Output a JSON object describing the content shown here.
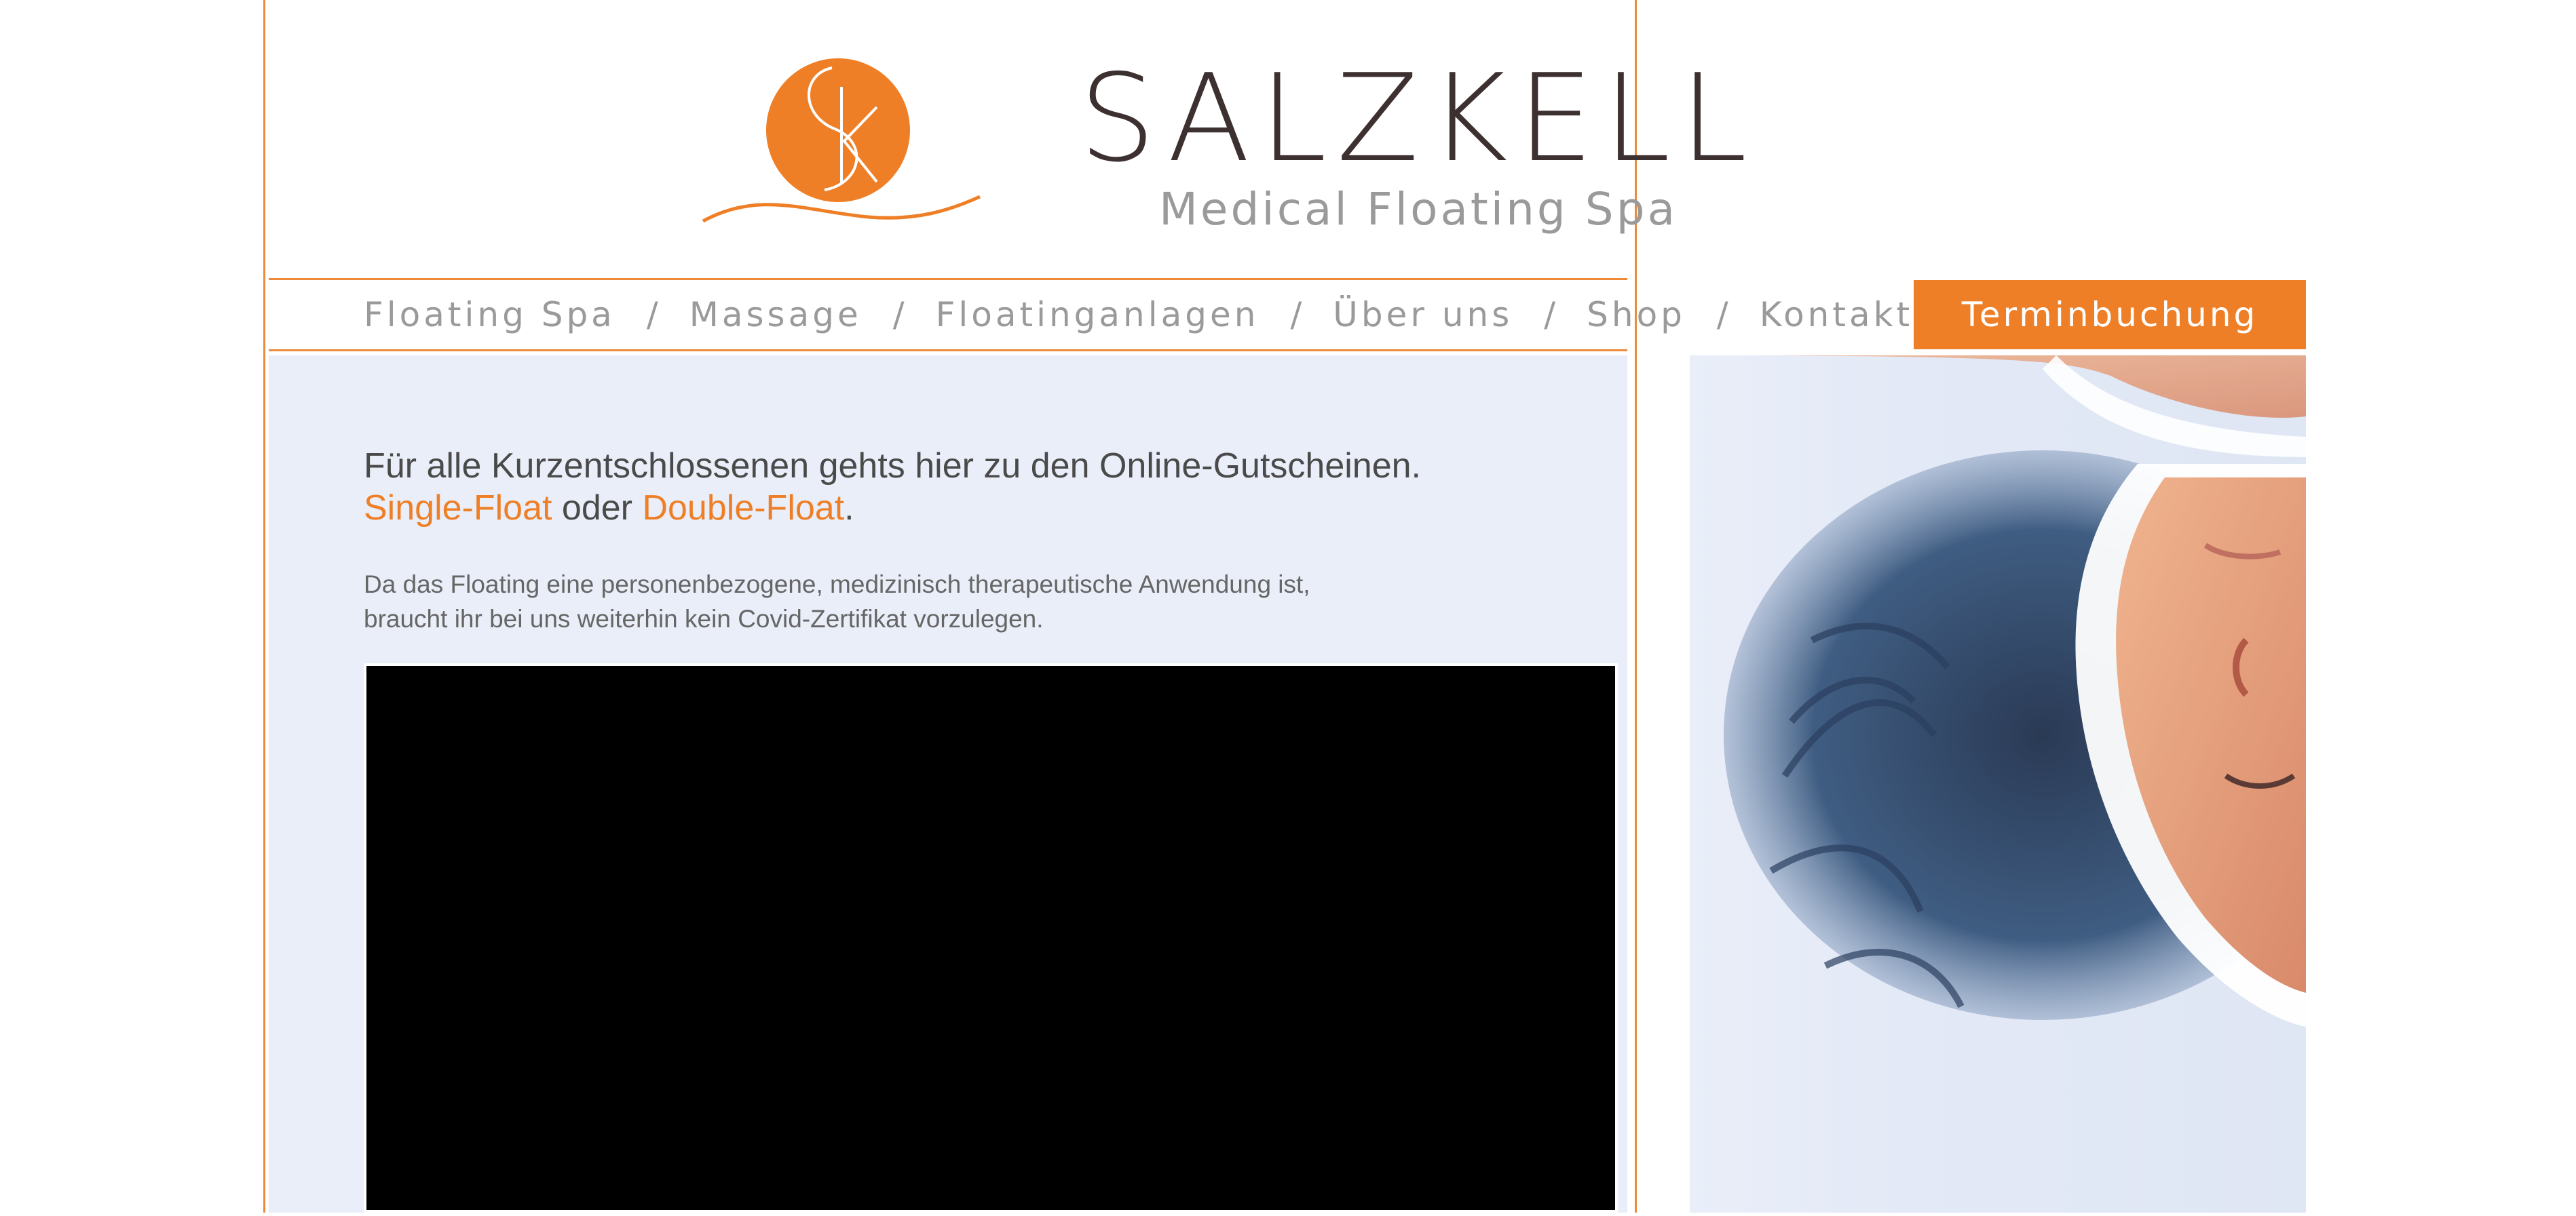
{
  "brand": {
    "logo_letters": "SK",
    "name": "SALZKELLER",
    "tagline": "Medical Floating Spa",
    "colors": {
      "accent": "#ef7f26",
      "border": "#ec8a3a",
      "text": "#4a4a4a",
      "hero_bg": "#e9eef9"
    }
  },
  "nav": {
    "items": [
      {
        "label": "Floating Spa"
      },
      {
        "label": "Massage"
      },
      {
        "label": "Floatinganlagen"
      },
      {
        "label": "Über uns"
      },
      {
        "label": "Shop"
      },
      {
        "label": "Kontakt"
      }
    ],
    "separator": "/",
    "booking_label": "Terminbuchung"
  },
  "main": {
    "headline": "Für alle Kurzentschlossenen gehts hier zu den Online-Gutscheinen.",
    "link_single": "Single-Float",
    "link_connector": " oder ",
    "link_double": "Double-Float",
    "link_end": ".",
    "notice_line1": "Da das Floating eine personenbezogene, medizinisch therapeutische Anwendung ist,",
    "notice_line2": "braucht ihr bei uns weiterhin kein Covid-Zertifikat vorzulegen."
  }
}
